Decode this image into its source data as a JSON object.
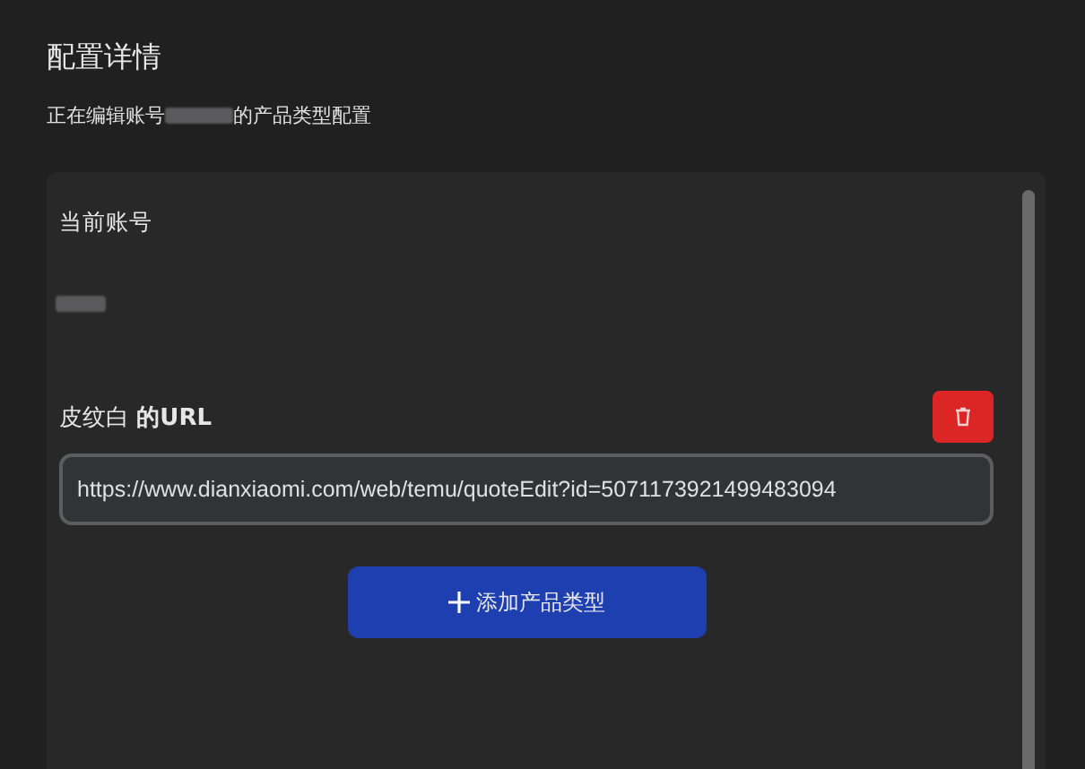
{
  "page": {
    "title": "配置详情",
    "subtitle_before": "正在编辑账号",
    "subtitle_after": "的产品类型配置"
  },
  "account": {
    "label": "当前账号"
  },
  "product_types": [
    {
      "label": "皮纹白 **的URL**",
      "url": "https://www.dianxiaomi.com/web/temu/quoteEdit?id=5071173921499483094"
    }
  ],
  "add_button": {
    "label": "添加产品类型"
  }
}
